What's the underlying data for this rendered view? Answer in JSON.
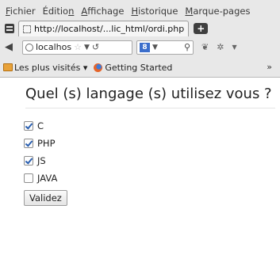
{
  "menubar": [
    {
      "underline": "F",
      "rest": "ichier"
    },
    {
      "pre": "Éditio",
      "underline": "n",
      "rest": ""
    },
    {
      "underline": "A",
      "rest": "ffichage"
    },
    {
      "underline": "H",
      "rest": "istorique"
    },
    {
      "underline": "M",
      "rest": "arque-pages"
    }
  ],
  "tab": {
    "title": "http://localhost/...lic_html/ordi.php",
    "new_tab": "+"
  },
  "nav": {
    "url": "localhos",
    "search_engine": "8",
    "icons": {
      "back": "arrow-left-icon",
      "star": "star-icon",
      "reload": "reload-icon",
      "search": "search-icon"
    }
  },
  "bookmarks": [
    {
      "label": "Les plus visités ▾",
      "icon": "folder-icon"
    },
    {
      "label": "Getting Started",
      "icon": "firefox-icon"
    }
  ],
  "bookmarks_overflow": "»",
  "form": {
    "question": "Quel (s) langage (s) utilisez vous ?",
    "options": [
      {
        "label": "C",
        "checked": true
      },
      {
        "label": "PHP",
        "checked": true
      },
      {
        "label": "JS",
        "checked": true
      },
      {
        "label": "JAVA",
        "checked": false
      }
    ],
    "submit_label": "Validez"
  }
}
